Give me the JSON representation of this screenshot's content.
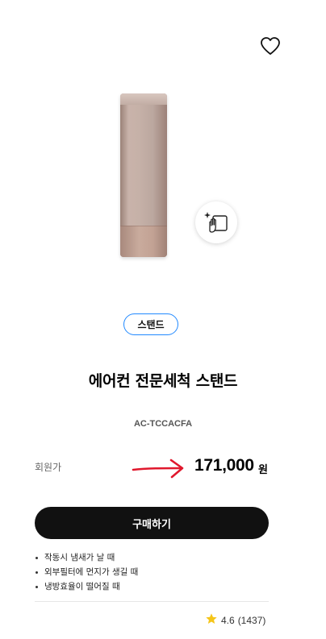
{
  "product": {
    "category": "스탠드",
    "name": "에어컨 전문세척 스탠드",
    "model": "AC-TCCACFA",
    "image_icon": "stand-air-conditioner-image",
    "badge_icon": "hand-wipe-cleaning-icon"
  },
  "price": {
    "label": "회원가",
    "amount": "171,000",
    "unit": "원"
  },
  "actions": {
    "buy_label": "구매하기",
    "wishlist_icon": "heart-icon"
  },
  "features": [
    "작동시 냄새가 날 때",
    "외부필터에 먼지가 생길 때",
    "냉방효율이 떨어질 때"
  ],
  "rating": {
    "score": "4.6",
    "count": "(1437)",
    "star_color": "#f5c518"
  },
  "colors": {
    "accent_blue": "#2189ff",
    "button_bg": "#111111",
    "arrow_red": "#e0182d"
  }
}
